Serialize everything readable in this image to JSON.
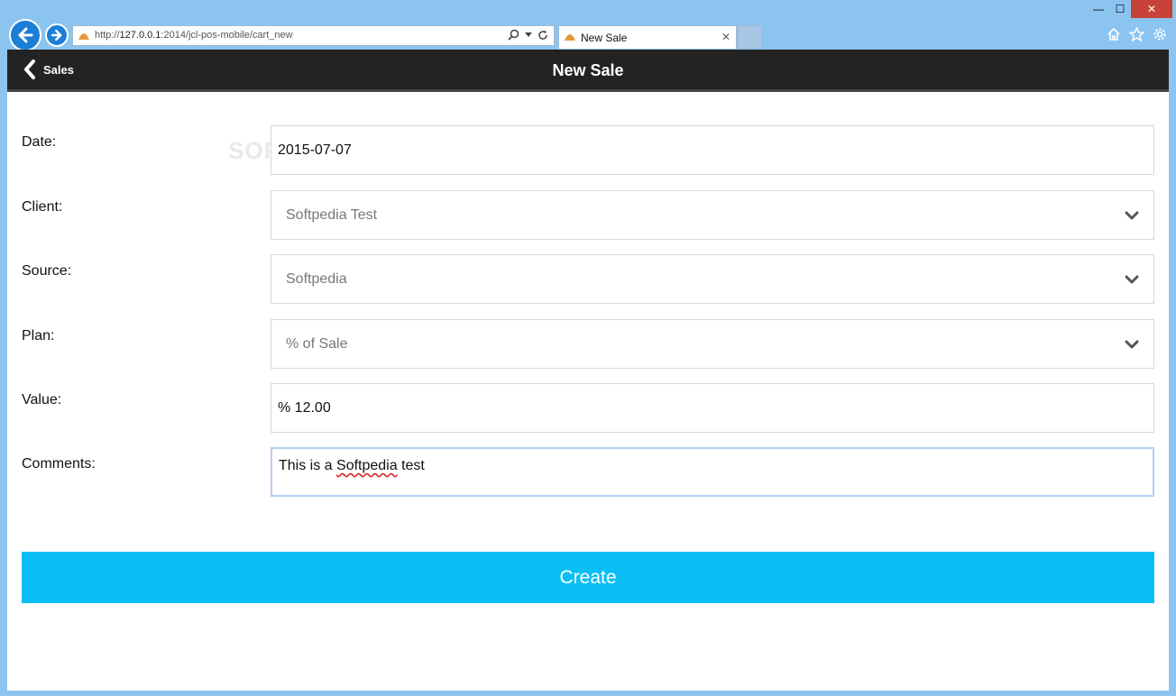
{
  "browser": {
    "url_prefix": "http://",
    "url_host": "127.0.0.1",
    "url_rest": ":2014/jcl-pos-mobile/cart_new",
    "tab_title": "New Sale",
    "tab_close": "✕",
    "window_min": "—",
    "window_max": "☐",
    "window_close": "✕"
  },
  "header": {
    "back_label": "Sales",
    "title": "New Sale"
  },
  "form": {
    "date_label": "Date:",
    "date_value": "2015-07-07",
    "client_label": "Client:",
    "client_value": "Softpedia Test",
    "source_label": "Source:",
    "source_value": "Softpedia",
    "plan_label": "Plan:",
    "plan_value": "% of Sale",
    "value_label": "Value:",
    "value_value": "% 12.00",
    "comments_label": "Comments:",
    "comments_pre": "This is a ",
    "comments_word": "Softpedia",
    "comments_post": " test",
    "create_label": "Create"
  },
  "watermark": "SOFTPEDIA",
  "colors": {
    "header_bg": "#232323",
    "create_bg": "#0bbff5"
  }
}
